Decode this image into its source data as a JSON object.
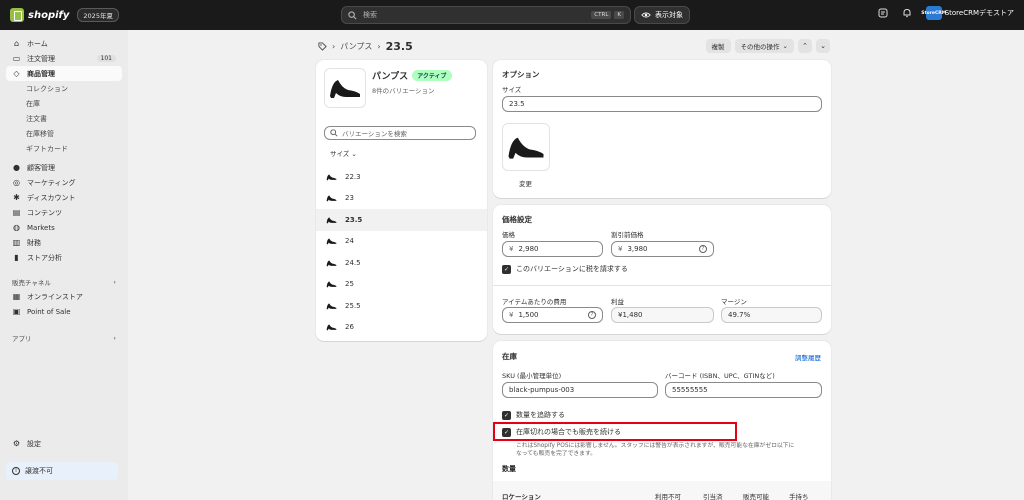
{
  "topbar": {
    "logo_text": "shopify",
    "edition": "2025年夏",
    "search_placeholder": "検索",
    "kbd_ctrl": "CTRL",
    "kbd_k": "K",
    "view_label": "表示対象",
    "store_name": "StoreCRMデモストア",
    "store_badge": "StoreCRM"
  },
  "sidebar": {
    "items": [
      {
        "label": "ホーム",
        "icon": "home-icon"
      },
      {
        "label": "注文管理",
        "icon": "inbox-icon",
        "count": "101"
      },
      {
        "label": "商品管理",
        "icon": "tag-icon",
        "active": true
      },
      {
        "label": "コレクション",
        "sub": true
      },
      {
        "label": "在庫",
        "sub": true
      },
      {
        "label": "注文書",
        "sub": true
      },
      {
        "label": "在庫移管",
        "sub": true
      },
      {
        "label": "ギフトカード",
        "sub": true
      },
      {
        "label": "顧客管理",
        "icon": "person-icon"
      },
      {
        "label": "マーケティング",
        "icon": "target-icon"
      },
      {
        "label": "ディスカウント",
        "icon": "discount-icon"
      },
      {
        "label": "コンテンツ",
        "icon": "content-icon"
      },
      {
        "label": "Markets",
        "icon": "globe-icon"
      },
      {
        "label": "財務",
        "icon": "bank-icon"
      },
      {
        "label": "ストア分析",
        "icon": "chart-icon"
      }
    ],
    "sales_channel_title": "販売チャネル",
    "channels": [
      {
        "label": "オンラインストア",
        "icon": "store-icon"
      },
      {
        "label": "Point of Sale",
        "icon": "pos-icon"
      }
    ],
    "apps_title": "アプリ",
    "settings_label": "設定",
    "notice_label": "譲渡不可"
  },
  "header": {
    "breadcrumb_parent": "パンプス",
    "current": "23.5",
    "duplicate_label": "複製",
    "more_actions_label": "その他の操作"
  },
  "product": {
    "name": "パンプス",
    "status": "アクティブ",
    "variant_count": "8件のバリエーション",
    "variant_search_placeholder": "バリエーションを検索",
    "size_filter": "サイズ",
    "variants": [
      "22.3",
      "23",
      "23.5",
      "24",
      "24.5",
      "25",
      "25.5",
      "26"
    ],
    "selected_variant": "23.5"
  },
  "options": {
    "title": "オプション",
    "size_label": "サイズ",
    "size_value": "23.5",
    "change_label": "変更"
  },
  "pricing": {
    "title": "価格設定",
    "price_label": "価格",
    "price_value": "2,980",
    "compare_label": "割引前価格",
    "compare_value": "3,980",
    "currency": "¥",
    "tax_label": "このバリエーションに税を請求する",
    "cost_label": "アイテムあたりの費用",
    "cost_value": "1,500",
    "profit_label": "利益",
    "profit_value": "¥1,480",
    "margin_label": "マージン",
    "margin_value": "49.7%"
  },
  "inventory": {
    "title": "在庫",
    "history_link": "調整履歴",
    "sku_label": "SKU (最小管理単位)",
    "sku_value": "black-pumpus-003",
    "barcode_label": "バーコード (ISBN、UPC、GTINなど)",
    "barcode_value": "55555555",
    "track_label": "数量を追跡する",
    "continue_label": "在庫切れの場合でも販売を続ける",
    "note_line1": "これはShopify POSには影響しません。スタッフには警告が表示されますが、販売可能な在庫がゼロ以下に",
    "note_line2": "なっても販売を完了できます。",
    "qty_title": "数量",
    "col_location": "ロケーション",
    "col_unavailable": "利用不可",
    "col_committed": "引当済",
    "col_available": "販売可能",
    "col_on_hand": "手持ち"
  },
  "colors": {
    "topbar": "#1a1a1a",
    "highlight": "#e60012",
    "active_badge": "#affebf",
    "link": "#005bd3"
  }
}
